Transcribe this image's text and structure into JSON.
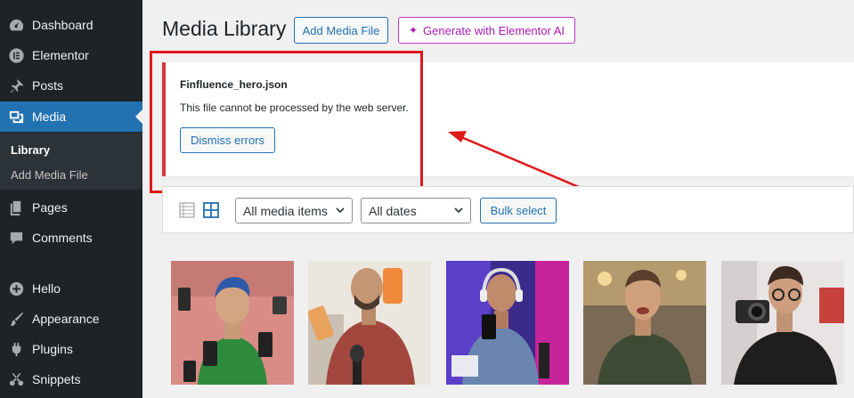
{
  "sidebar": {
    "items": [
      {
        "label": "Dashboard",
        "icon": "dashboard-icon"
      },
      {
        "label": "Elementor",
        "icon": "elementor-icon"
      },
      {
        "label": "Posts",
        "icon": "pin-icon"
      },
      {
        "label": "Media",
        "icon": "media-icon",
        "active": true
      },
      {
        "label": "Pages",
        "icon": "pages-icon"
      },
      {
        "label": "Comments",
        "icon": "comment-icon"
      },
      {
        "label": "Hello",
        "icon": "plus-circle-icon"
      },
      {
        "label": "Appearance",
        "icon": "brush-icon"
      },
      {
        "label": "Plugins",
        "icon": "plug-icon"
      },
      {
        "label": "Snippets",
        "icon": "scissors-icon"
      }
    ],
    "submenu": [
      {
        "label": "Library",
        "current": true
      },
      {
        "label": "Add Media File"
      }
    ]
  },
  "header": {
    "title": "Media Library",
    "add_button": "Add Media File",
    "ai_button": "Generate with Elementor AI"
  },
  "notice": {
    "filename": "Finfluence_hero.json",
    "message": "This file cannot be processed by the web server.",
    "dismiss": "Dismiss errors"
  },
  "toolbar": {
    "filter_type": "All media items",
    "filter_date": "All dates",
    "bulk_select": "Bulk select"
  },
  "colors": {
    "accent": "#2271b1",
    "ai": "#a81bb1",
    "error": "#d63638",
    "annotation": "#e0191b"
  },
  "media_items": [
    {
      "subject": "man-blue-hair-holding-phone"
    },
    {
      "subject": "man-holding-phone-microphone"
    },
    {
      "subject": "man-headphones-neon-studio"
    },
    {
      "subject": "man-smiling-talking"
    },
    {
      "subject": "man-holding-camera"
    }
  ]
}
